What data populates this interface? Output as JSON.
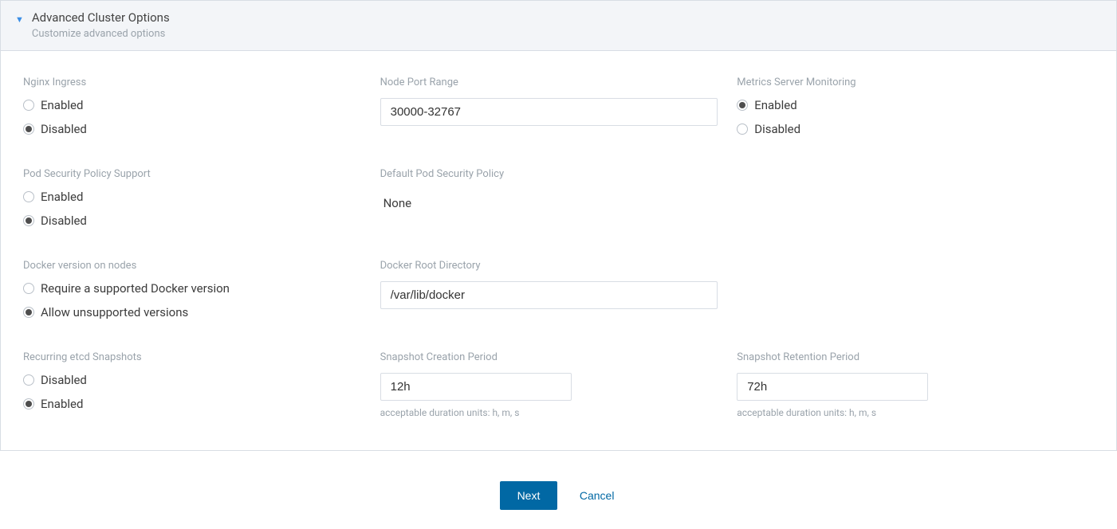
{
  "header": {
    "title": "Advanced Cluster Options",
    "subtitle": "Customize advanced options"
  },
  "labels": {
    "nginx_ingress": "Nginx Ingress",
    "node_port_range": "Node Port Range",
    "metrics_server": "Metrics Server Monitoring",
    "pod_security_support": "Pod Security Policy Support",
    "default_pod_security": "Default Pod Security Policy",
    "docker_version": "Docker version on nodes",
    "docker_root": "Docker Root Directory",
    "etcd_snapshots": "Recurring etcd Snapshots",
    "snapshot_creation": "Snapshot Creation Period",
    "snapshot_retention": "Snapshot Retention Period"
  },
  "options": {
    "enabled": "Enabled",
    "disabled": "Disabled",
    "require_docker": "Require a supported Docker version",
    "allow_docker": "Allow unsupported versions"
  },
  "values": {
    "node_port_range": "30000-32767",
    "default_pod_security": "None",
    "docker_root": "/var/lib/docker",
    "snapshot_creation": "12h",
    "snapshot_retention": "72h"
  },
  "helper": {
    "duration_units": "acceptable duration units: h, m, s"
  },
  "selections": {
    "nginx_ingress": "disabled",
    "metrics_server": "enabled",
    "pod_security_support": "disabled",
    "docker_version": "allow",
    "etcd_snapshots": "enabled"
  },
  "footer": {
    "next": "Next",
    "cancel": "Cancel"
  }
}
